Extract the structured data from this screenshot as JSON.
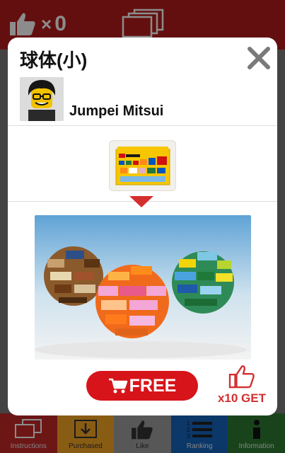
{
  "app": {
    "like_count": "0",
    "like_multiplier": "×"
  },
  "bottom_nav": [
    {
      "label": "Instructions",
      "color": "#c62828"
    },
    {
      "label": "Purchased",
      "color": "#f9a825"
    },
    {
      "label": "Like",
      "color": "#9e9e9e"
    },
    {
      "label": "Ranking",
      "color": "#1565c0"
    },
    {
      "label": "Information",
      "color": "#2e7d32"
    }
  ],
  "modal": {
    "title": "球体(小)",
    "author_name": "Jumpei Mitsui",
    "free_label": "FREE",
    "get_label": "x10 GET"
  },
  "colors": {
    "accent": "#d7141a",
    "brand_red": "#b71c1c"
  }
}
